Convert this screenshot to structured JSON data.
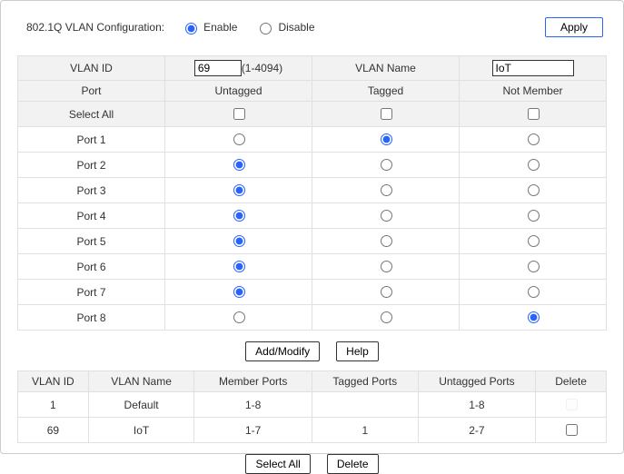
{
  "header": {
    "config_label": "802.1Q VLAN Configuration:",
    "enable_label": "Enable",
    "disable_label": "Disable",
    "apply_label": "Apply"
  },
  "vlan_form": {
    "vlan_id_header": "VLAN ID",
    "vlan_id_value": "69",
    "vlan_id_range": "(1-4094)",
    "vlan_name_header": "VLAN Name",
    "vlan_name_value": "IoT"
  },
  "port_table": {
    "port_header": "Port",
    "untagged_header": "Untagged",
    "tagged_header": "Tagged",
    "notmember_header": "Not Member",
    "select_all_label": "Select All",
    "ports": [
      {
        "label": "Port 1",
        "selected": "tagged"
      },
      {
        "label": "Port 2",
        "selected": "untagged"
      },
      {
        "label": "Port 3",
        "selected": "untagged"
      },
      {
        "label": "Port 4",
        "selected": "untagged"
      },
      {
        "label": "Port 5",
        "selected": "untagged"
      },
      {
        "label": "Port 6",
        "selected": "untagged"
      },
      {
        "label": "Port 7",
        "selected": "untagged"
      },
      {
        "label": "Port 8",
        "selected": "notmember"
      }
    ]
  },
  "buttons": {
    "add_modify": "Add/Modify",
    "help": "Help",
    "select_all": "Select All",
    "delete": "Delete"
  },
  "member_table": {
    "headers": {
      "vlan_id": "VLAN ID",
      "vlan_name": "VLAN Name",
      "member_ports": "Member Ports",
      "tagged_ports": "Tagged Ports",
      "untagged_ports": "Untagged Ports",
      "delete": "Delete"
    },
    "rows": [
      {
        "id": "1",
        "name": "Default",
        "member_ports": "1-8",
        "tagged_ports": "",
        "untagged_ports": "1-8",
        "deletable": false
      },
      {
        "id": "69",
        "name": "IoT",
        "member_ports": "1-7",
        "tagged_ports": "1",
        "untagged_ports": "2-7",
        "deletable": true
      }
    ]
  }
}
